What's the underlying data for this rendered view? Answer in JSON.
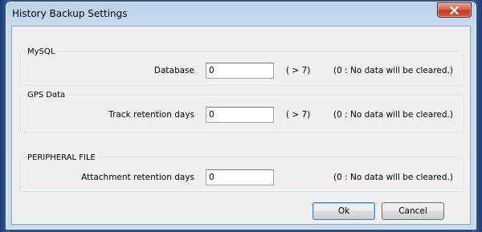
{
  "window": {
    "title": "History Backup Settings",
    "close_symbol": "×"
  },
  "groups": {
    "mysql": {
      "legend": "MySQL",
      "label": "Database",
      "value": "0",
      "range_hint": "( > 7)",
      "note": "(0 : No data will be cleared.)"
    },
    "gps": {
      "legend": "GPS Data",
      "label": "Track retention days",
      "value": "0",
      "range_hint": "( > 7)",
      "note": "(0 : No data will be cleared.)"
    },
    "peripheral": {
      "legend": "PERIPHERAL FILE",
      "label": "Attachment retention days",
      "value": "0",
      "note": "(0 : No data will be cleared.)"
    }
  },
  "buttons": {
    "ok": "Ok",
    "cancel": "Cancel"
  },
  "icons": {
    "close": "close-icon"
  },
  "colors": {
    "close_button": "#c94a33",
    "window_frame": "#c7dbef",
    "client_bg": "#f0f0f0"
  }
}
